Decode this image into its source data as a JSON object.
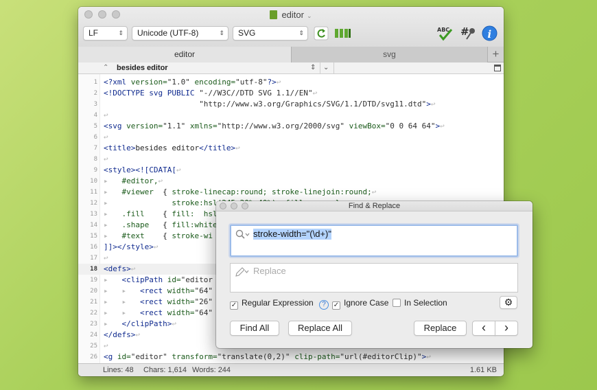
{
  "window": {
    "title": "editor",
    "toolbar": {
      "line_ending": "LF",
      "encoding": "Unicode (UTF-8)",
      "syntax": "SVG"
    },
    "tabs": [
      {
        "label": "editor",
        "active": true
      },
      {
        "label": "svg",
        "active": false
      }
    ],
    "navbar": {
      "crumb": "besides editor"
    },
    "code_lines": [
      {
        "n": "1",
        "html": "<span class='tag'>&lt;?xml</span> <span class='attr'>version=</span><span class='str'>\"1.0\"</span> <span class='attr'>encoding=</span><span class='str'>\"utf-8\"</span><span class='tag'>?&gt;</span><span class='inv'>↩</span>"
      },
      {
        "n": "2",
        "html": "<span class='tag'>&lt;!DOCTYPE svg PUBLIC</span> <span class='str'>\"-//W3C//DTD SVG 1.1//EN\"</span><span class='inv'>↩</span>"
      },
      {
        "n": "3",
        "html": "                     <span class='str'>\"http://www.w3.org/Graphics/SVG/1.1/DTD/svg11.dtd\"</span><span class='tag'>&gt;</span><span class='inv'>↩</span>"
      },
      {
        "n": "4",
        "html": "<span class='inv'>↩</span>"
      },
      {
        "n": "5",
        "html": "<span class='tag'>&lt;svg</span> <span class='attr'>version=</span><span class='str'>\"1.1\"</span> <span class='attr'>xmlns=</span><span class='str'>\"http://www.w3.org/2000/svg\"</span> <span class='attr'>viewBox=</span><span class='str'>\"0 0 64 64\"</span><span class='tag'>&gt;</span><span class='inv'>↩</span>"
      },
      {
        "n": "6",
        "html": "<span class='inv'>↩</span>"
      },
      {
        "n": "7",
        "html": "<span class='tag'>&lt;title&gt;</span>besides editor<span class='tag'>&lt;/title&gt;</span><span class='inv'>↩</span>"
      },
      {
        "n": "8",
        "html": "<span class='inv'>↩</span>"
      },
      {
        "n": "9",
        "html": "<span class='tag'>&lt;style&gt;&lt;![CDATA[</span><span class='inv'>↩</span>"
      },
      {
        "n": "10",
        "html": "<span class='inv'>▸</span>   <span class='attr'>#editor,</span><span class='inv'>↩</span>"
      },
      {
        "n": "11",
        "html": "<span class='inv'>▸</span>   <span class='attr'>#viewer</span>  { <span class='attr'>stroke-linecap:round; stroke-linejoin:round;</span><span class='inv'>↩</span>"
      },
      {
        "n": "12",
        "html": "<span class='inv'>▸</span>              <span class='attr'>stroke:hsl(245,20%,40%); fill: none;}</span><span class='inv'>↩</span>"
      },
      {
        "n": "13",
        "html": "<span class='inv'>▸</span>   <span class='attr'>.fill</span>    { <span class='attr'>fill:  hsl</span>"
      },
      {
        "n": "14",
        "html": "<span class='inv'>▸</span>   <span class='attr'>.shape</span>   { <span class='attr'>fill:white</span>"
      },
      {
        "n": "15",
        "html": "<span class='inv'>▸</span>   <span class='attr'>#text</span>    { <span class='attr'>stroke-wi</span>"
      },
      {
        "n": "16",
        "html": "<span class='tag'>]]&gt;&lt;/style&gt;</span><span class='inv'>↩</span>"
      },
      {
        "n": "17",
        "html": "<span class='inv'>↩</span>"
      },
      {
        "n": "18",
        "html": "<span class='tag'>&lt;defs&gt;</span><span class='inv'>↩</span>"
      },
      {
        "n": "19",
        "html": "<span class='inv'>▸</span>   <span class='tag'>&lt;clipPath</span> <span class='attr'>id=</span><span class='str'>\"editor</span>"
      },
      {
        "n": "20",
        "html": "<span class='inv'>▸</span>   <span class='inv'>▸</span>   <span class='tag'>&lt;rect</span> <span class='attr'>width=</span><span class='str'>\"64\"</span>"
      },
      {
        "n": "21",
        "html": "<span class='inv'>▸</span>   <span class='inv'>▸</span>   <span class='tag'>&lt;rect</span> <span class='attr'>width=</span><span class='str'>\"26\"</span>"
      },
      {
        "n": "22",
        "html": "<span class='inv'>▸</span>   <span class='inv'>▸</span>   <span class='tag'>&lt;rect</span> <span class='attr'>width=</span><span class='str'>\"64\"</span>"
      },
      {
        "n": "23",
        "html": "<span class='inv'>▸</span>   <span class='tag'>&lt;/clipPath&gt;</span><span class='inv'>↩</span>"
      },
      {
        "n": "24",
        "html": "<span class='tag'>&lt;/defs&gt;</span><span class='inv'>↩</span>"
      },
      {
        "n": "25",
        "html": "<span class='inv'>↩</span>"
      },
      {
        "n": "26",
        "html": "<span class='tag'>&lt;g</span> <span class='attr'>id=</span><span class='str'>\"editor\"</span> <span class='attr'>transform=</span><span class='str'>\"translate(0,2)\"</span> <span class='attr'>clip-path=</span><span class='str'>\"url(#editorClip)\"</span><span class='tag'>&gt;</span><span class='inv'>↩</span>"
      }
    ],
    "highlighted_line": "18",
    "status": {
      "lines": "Lines: 48",
      "chars": "Chars: 1,614",
      "words": "Words: 244",
      "size": "1.61 KB"
    }
  },
  "find_replace": {
    "title": "Find & Replace",
    "find_value": "stroke-width=\"(\\d+)\"",
    "replace_placeholder": "Replace",
    "options": {
      "regex_label": "Regular Expression",
      "regex_checked": true,
      "ignore_case_label": "Ignore Case",
      "ignore_case_checked": true,
      "in_selection_label": "In Selection",
      "in_selection_checked": false,
      "help": "?"
    },
    "buttons": {
      "find_all": "Find All",
      "replace_all": "Replace All",
      "replace": "Replace",
      "prev": "‹",
      "next": "›"
    }
  }
}
